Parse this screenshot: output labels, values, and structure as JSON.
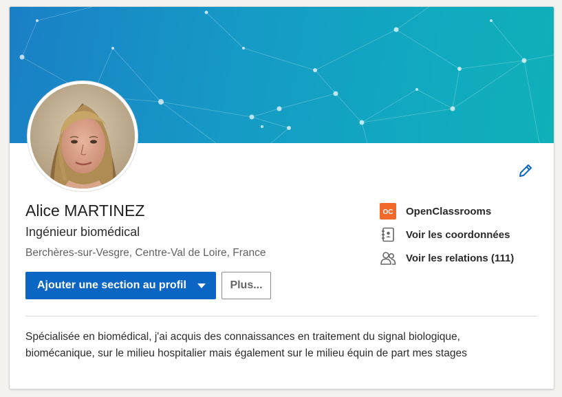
{
  "profile": {
    "name": "Alice MARTINEZ",
    "headline": "Ingénieur biomédical",
    "location": "Berchères-sur-Vesgre, Centre-Val de Loire, France",
    "summary": "Spécialisée en biomédical, j'ai acquis des connaissances en traitement du signal biologique, biomécanique, sur le milieu hospitalier mais également sur le milieu équin de part mes stages"
  },
  "actions": {
    "add_section_label": "Ajouter une section au profil",
    "more_label": "Plus..."
  },
  "sidebar": {
    "items": [
      {
        "label": "OpenClassrooms",
        "icon": "openclassrooms-logo-icon"
      },
      {
        "label": "Voir les coordonnées",
        "icon": "contact-card-icon"
      },
      {
        "label": "Voir les relations (111)",
        "icon": "people-icon"
      }
    ]
  },
  "colors": {
    "primary": "#0a66c2",
    "banner_start": "#1a7fc6",
    "banner_end": "#0fb0b8",
    "openclassrooms": "#f26a2a"
  }
}
